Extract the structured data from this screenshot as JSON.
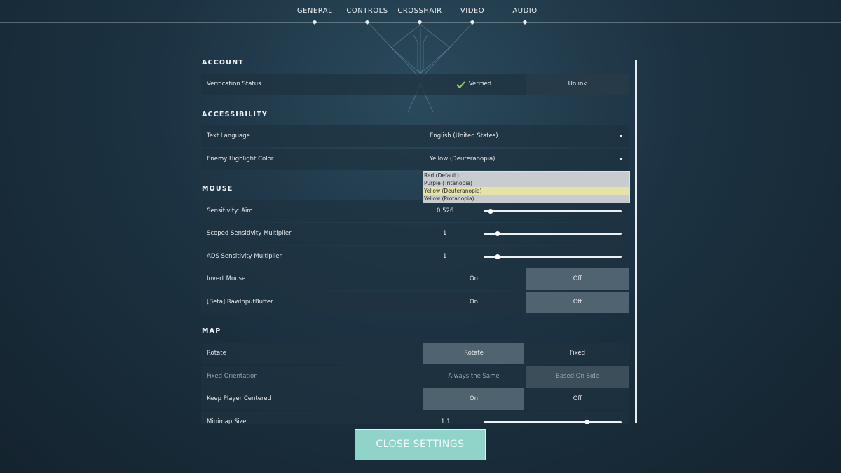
{
  "nav": {
    "tabs": [
      "GENERAL",
      "CONTROLS",
      "CROSSHAIR",
      "VIDEO",
      "AUDIO"
    ]
  },
  "account": {
    "title": "ACCOUNT",
    "verification": {
      "label": "Verification Status",
      "status": "Verified",
      "action": "Unlink"
    }
  },
  "accessibility": {
    "title": "ACCESSIBILITY",
    "text_language": {
      "label": "Text Language",
      "value": "English (United States)"
    },
    "enemy_highlight": {
      "label": "Enemy Highlight Color",
      "value": "Yellow (Deuteranopia)",
      "options": [
        "Red (Default)",
        "Purple (Tritanopia)",
        "Yellow (Deuteranopia)",
        "Yellow (Protanopia)"
      ],
      "selected_index": 2
    }
  },
  "mouse": {
    "title": "MOUSE",
    "sensitivity_aim": {
      "label": "Sensitivity: Aim",
      "value": "0.526",
      "slider_fraction": 0.05
    },
    "scoped_multiplier": {
      "label": "Scoped Sensitivity Multiplier",
      "value": "1",
      "slider_fraction": 0.1
    },
    "ads_multiplier": {
      "label": "ADS Sensitivity Multiplier",
      "value": "1",
      "slider_fraction": 0.1
    },
    "invert_mouse": {
      "label": "Invert Mouse",
      "on": "On",
      "off": "Off",
      "selected": "Off"
    },
    "raw_input": {
      "label": "[Beta] RawInputBuffer",
      "on": "On",
      "off": "Off",
      "selected": "Off"
    }
  },
  "map": {
    "title": "MAP",
    "rotate": {
      "label": "Rotate",
      "option_a": "Rotate",
      "option_b": "Fixed",
      "selected": "Rotate"
    },
    "fixed_orientation": {
      "label": "Fixed Orientation",
      "option_a": "Always the Same",
      "option_b": "Based On Side",
      "selected": "Based On Side"
    },
    "keep_centered": {
      "label": "Keep Player Centered",
      "option_a": "On",
      "option_b": "Off",
      "selected": "On"
    },
    "minimap_size": {
      "label": "Minimap Size",
      "value": "1.1",
      "slider_fraction": 0.75
    }
  },
  "footer": {
    "close_label": "CLOSE SETTINGS"
  },
  "colors": {
    "accent": "#8fd3c9",
    "verified_check": "#8fd16a",
    "dropdown_selected": "#e6e3a9"
  }
}
